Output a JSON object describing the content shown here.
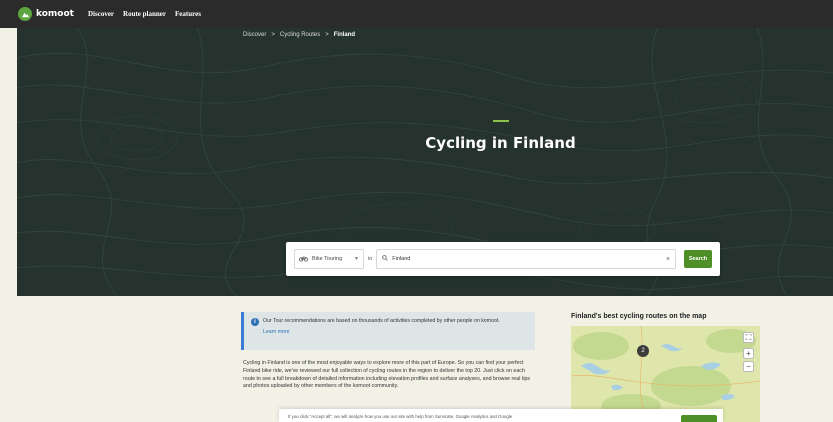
{
  "nav": {
    "logo_text": "komoot",
    "links": [
      "Discover",
      "Route planner",
      "Features"
    ]
  },
  "breadcrumb": {
    "items": [
      "Discover",
      "Cycling Routes",
      "Finland"
    ],
    "separator": ">"
  },
  "hero": {
    "title": "Cycling in Finland"
  },
  "search": {
    "sport": "Bike Touring",
    "in_label": "in",
    "location": "Finland",
    "button_label": "Search"
  },
  "info": {
    "text": "Our Tour recommendations are based on thousands of activities completed by other people on komoot.",
    "learn_more": "Learn more"
  },
  "intro_paragraph": "Cycling in Finland is one of the most enjoyable ways to explore more of this part of Europe. So you can find your perfect Finland bike ride, we've reviewed our full collection of cycling routes in the region to deliver the top 20. Just click on each route to see a full breakdown of detailed information including elevation profiles and surface analyses, and browse real tips and photos uploaded by other members of the komoot community.",
  "map": {
    "title": "Finland's best cycling routes on the map",
    "cluster_count": "2",
    "zoom_in": "+",
    "zoom_out": "−"
  },
  "cookie": {
    "text": "If you click \"Accept all\", we will analyze how you use our site with help from Survicate, Google Analytics and Google"
  },
  "colors": {
    "brand_green": "#5da540",
    "search_button": "#4f8f27",
    "hero_bg": "#25322d",
    "accent": "#8ac34a",
    "info_border": "#3a7bd5"
  }
}
